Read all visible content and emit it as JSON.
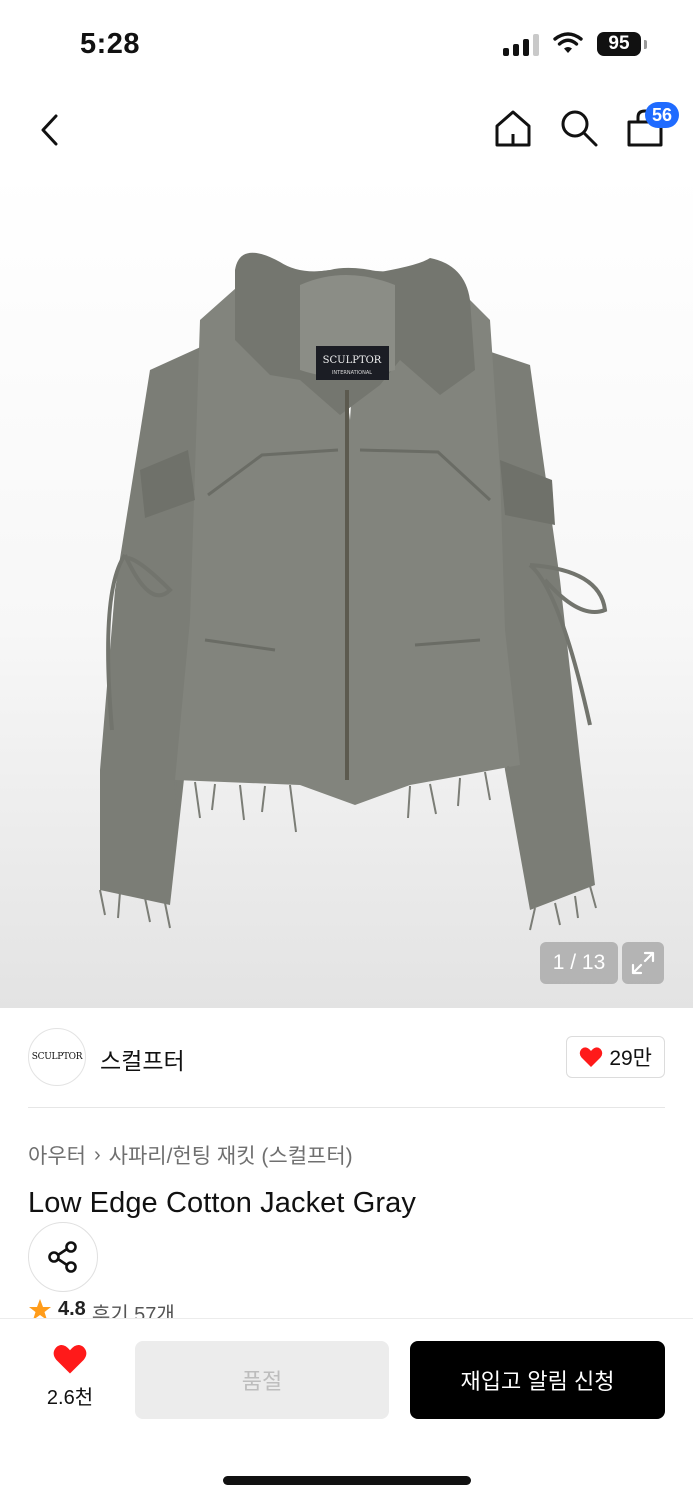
{
  "status_bar": {
    "time": "5:28",
    "battery": "95",
    "icons": [
      "signal-icon",
      "wifi-icon",
      "battery-icon"
    ]
  },
  "nav": {
    "icons": [
      "back-icon",
      "home-icon",
      "search-icon",
      "cart-icon"
    ],
    "cart_count": "56"
  },
  "gallery": {
    "counter": "1 / 13",
    "image_subject": "jacket-photo",
    "label_text": "SCULPTOR",
    "label_subtext": "INTERNATIONAL",
    "colors": {
      "jacket": "#7e8079",
      "jacket_shadow": "#6d6f69",
      "background_bottom": "#e3e3e3"
    }
  },
  "brand": {
    "logo_text": "SCULPTOR",
    "name": "스컬프터",
    "like_count": "29만"
  },
  "breadcrumb": {
    "items": [
      "아우터",
      "사파리/헌팅 재킷 (스컬프터)"
    ]
  },
  "product": {
    "title": "Low Edge Cotton Jacket Gray",
    "rating": "4.8",
    "reviews": "후기 57개"
  },
  "bottom_bar": {
    "wish_count": "2.6천",
    "soldout_label": "품절",
    "restock_label": "재입고 알림 신청"
  },
  "colors": {
    "accent_blue": "#1f6bff",
    "heart_red": "#ff1a1a",
    "star_orange": "#ff9c1a",
    "primary_button": "#000000"
  }
}
